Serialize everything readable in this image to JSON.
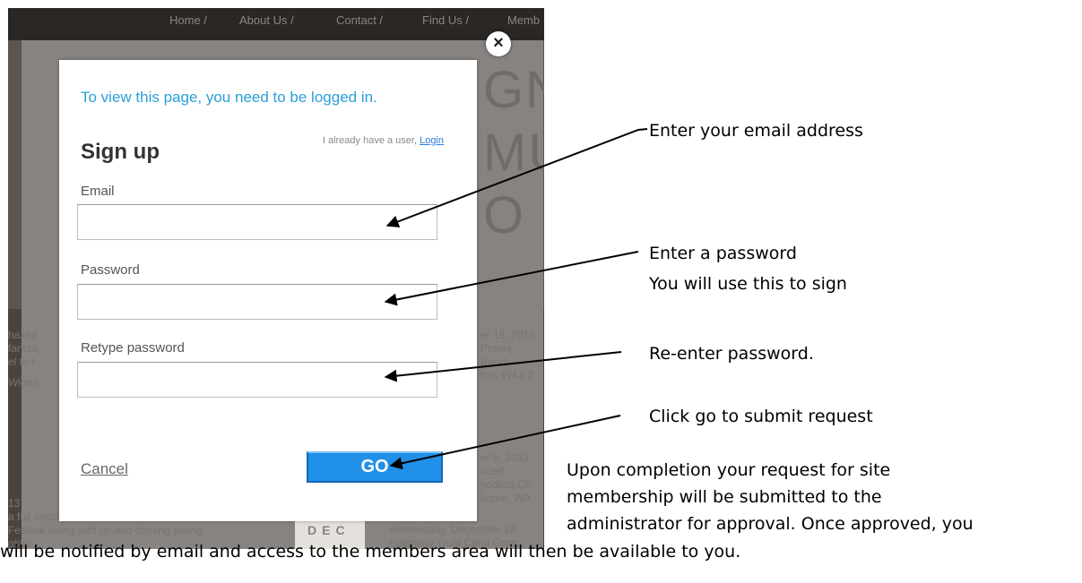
{
  "background": {
    "nav": [
      "Home /",
      "About Us /",
      "Contact /",
      "Find Us /",
      "Memb"
    ],
    "hero_fragments": [
      "GN",
      "MU",
      "O"
    ],
    "left_fragments": [
      "hazed",
      "fantas",
      "el to t",
      "Wigon"
    ],
    "right_fragments": [
      "er 19, 2013",
      "Proms",
      "Band",
      "ton, WA3 2",
      "er 5, 2013",
      "ncert",
      "hodists Ch",
      "borne, WA"
    ],
    "bottom_left": [
      "13",
      "a full concert on the final night of the",
      "Festival along with up and coming young",
      "ghlin"
    ],
    "bottom_right": [
      "Wednesday, December 18,",
      "Epiphany Trust Carol Conc"
    ],
    "dec_badge": "DEC"
  },
  "modal": {
    "close_symbol": "×",
    "login_message": "To view this page, you need to be logged in.",
    "title": "Sign up",
    "already_text": "I already have a user, ",
    "login_link": "Login",
    "email_label": "Email",
    "email_value": "",
    "password_label": "Password",
    "password_value": "",
    "retype_label": "Retype password",
    "retype_value": "",
    "cancel_label": "Cancel",
    "go_label": "GO"
  },
  "annotations": {
    "email": "Enter your email address",
    "password_line1": "Enter a password",
    "password_line2": "You will use this to sign",
    "retype": "Re-enter password.",
    "go": "Click go to submit request",
    "completion_line1": "Upon completion your request for site",
    "completion_line2": "membership will be submitted to the",
    "completion_line3": "administrator for approval. Once approved, you",
    "completion_line4": "will be notified by email and access to the members area will then be available to you."
  },
  "colors": {
    "link_blue": "#2a9fd8",
    "go_button": "#2190e8",
    "overlay": "#878380"
  }
}
